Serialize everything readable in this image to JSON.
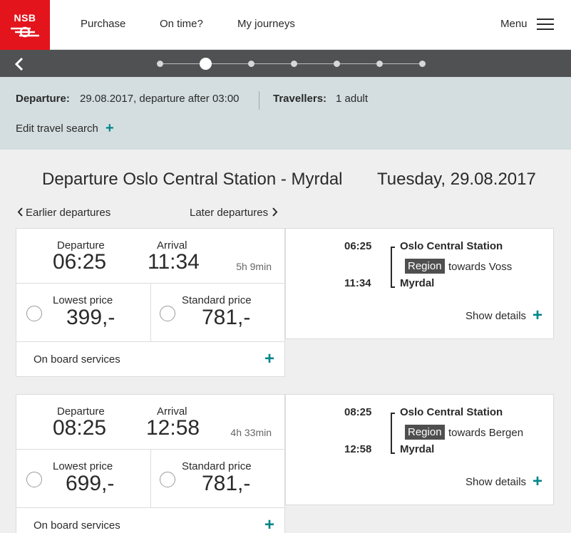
{
  "nav": {
    "logo_text": "NSB",
    "links": [
      "Purchase",
      "On time?",
      "My journeys"
    ],
    "menu_label": "Menu"
  },
  "progress": {
    "steps": 7,
    "active_step": 2
  },
  "summary": {
    "departure_label": "Departure:",
    "departure_value": "29.08.2017, departure after 03:00",
    "travellers_label": "Travellers:",
    "travellers_value": "1 adult",
    "edit_label": "Edit travel search"
  },
  "heading": {
    "route": "Departure Oslo Central Station - Myrdal",
    "date": "Tuesday, 29.08.2017"
  },
  "paging": {
    "earlier": "Earlier departures",
    "later": "Later departures"
  },
  "labels": {
    "departure": "Departure",
    "arrival": "Arrival",
    "lowest_price": "Lowest price",
    "standard_price": "Standard price",
    "on_board": "On board services",
    "show_details": "Show details",
    "region_badge": "Region"
  },
  "journeys": [
    {
      "departure": "06:25",
      "arrival": "11:34",
      "duration": "5h 9min",
      "lowest_price": "399,-",
      "standard_price": "781,-",
      "from_station": "Oslo Central Station",
      "to_station": "Myrdal",
      "towards": "towards Voss"
    },
    {
      "departure": "08:25",
      "arrival": "12:58",
      "duration": "4h 33min",
      "lowest_price": "699,-",
      "standard_price": "781,-",
      "from_station": "Oslo Central Station",
      "to_station": "Myrdal",
      "towards": "towards Bergen"
    }
  ],
  "colors": {
    "brand_red": "#e3141c",
    "accent_teal": "#00868b",
    "progress_bg": "#4f5153",
    "summary_bg": "#d4dee0"
  }
}
